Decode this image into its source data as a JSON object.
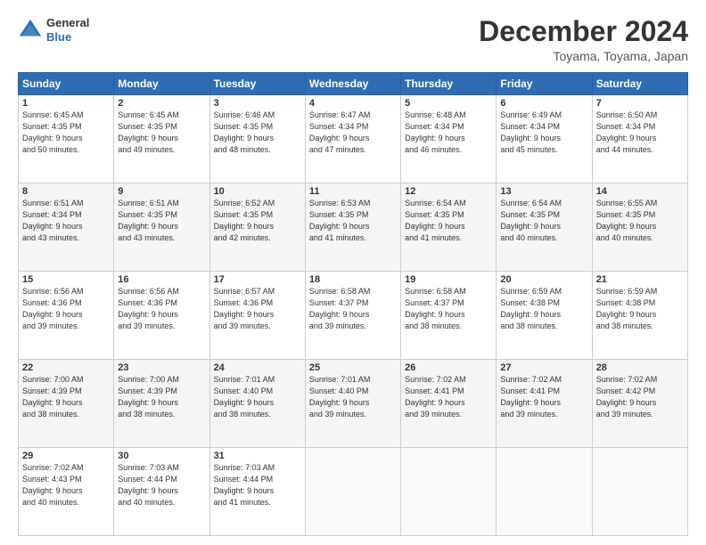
{
  "header": {
    "logo_general": "General",
    "logo_blue": "Blue",
    "month_title": "December 2024",
    "location": "Toyama, Toyama, Japan"
  },
  "weekdays": [
    "Sunday",
    "Monday",
    "Tuesday",
    "Wednesday",
    "Thursday",
    "Friday",
    "Saturday"
  ],
  "weeks": [
    [
      {
        "day": "1",
        "info": "Sunrise: 6:45 AM\nSunset: 4:35 PM\nDaylight: 9 hours\nand 50 minutes."
      },
      {
        "day": "2",
        "info": "Sunrise: 6:45 AM\nSunset: 4:35 PM\nDaylight: 9 hours\nand 49 minutes."
      },
      {
        "day": "3",
        "info": "Sunrise: 6:46 AM\nSunset: 4:35 PM\nDaylight: 9 hours\nand 48 minutes."
      },
      {
        "day": "4",
        "info": "Sunrise: 6:47 AM\nSunset: 4:34 PM\nDaylight: 9 hours\nand 47 minutes."
      },
      {
        "day": "5",
        "info": "Sunrise: 6:48 AM\nSunset: 4:34 PM\nDaylight: 9 hours\nand 46 minutes."
      },
      {
        "day": "6",
        "info": "Sunrise: 6:49 AM\nSunset: 4:34 PM\nDaylight: 9 hours\nand 45 minutes."
      },
      {
        "day": "7",
        "info": "Sunrise: 6:50 AM\nSunset: 4:34 PM\nDaylight: 9 hours\nand 44 minutes."
      }
    ],
    [
      {
        "day": "8",
        "info": "Sunrise: 6:51 AM\nSunset: 4:34 PM\nDaylight: 9 hours\nand 43 minutes."
      },
      {
        "day": "9",
        "info": "Sunrise: 6:51 AM\nSunset: 4:35 PM\nDaylight: 9 hours\nand 43 minutes."
      },
      {
        "day": "10",
        "info": "Sunrise: 6:52 AM\nSunset: 4:35 PM\nDaylight: 9 hours\nand 42 minutes."
      },
      {
        "day": "11",
        "info": "Sunrise: 6:53 AM\nSunset: 4:35 PM\nDaylight: 9 hours\nand 41 minutes."
      },
      {
        "day": "12",
        "info": "Sunrise: 6:54 AM\nSunset: 4:35 PM\nDaylight: 9 hours\nand 41 minutes."
      },
      {
        "day": "13",
        "info": "Sunrise: 6:54 AM\nSunset: 4:35 PM\nDaylight: 9 hours\nand 40 minutes."
      },
      {
        "day": "14",
        "info": "Sunrise: 6:55 AM\nSunset: 4:35 PM\nDaylight: 9 hours\nand 40 minutes."
      }
    ],
    [
      {
        "day": "15",
        "info": "Sunrise: 6:56 AM\nSunset: 4:36 PM\nDaylight: 9 hours\nand 39 minutes."
      },
      {
        "day": "16",
        "info": "Sunrise: 6:56 AM\nSunset: 4:36 PM\nDaylight: 9 hours\nand 39 minutes."
      },
      {
        "day": "17",
        "info": "Sunrise: 6:57 AM\nSunset: 4:36 PM\nDaylight: 9 hours\nand 39 minutes."
      },
      {
        "day": "18",
        "info": "Sunrise: 6:58 AM\nSunset: 4:37 PM\nDaylight: 9 hours\nand 39 minutes."
      },
      {
        "day": "19",
        "info": "Sunrise: 6:58 AM\nSunset: 4:37 PM\nDaylight: 9 hours\nand 38 minutes."
      },
      {
        "day": "20",
        "info": "Sunrise: 6:59 AM\nSunset: 4:38 PM\nDaylight: 9 hours\nand 38 minutes."
      },
      {
        "day": "21",
        "info": "Sunrise: 6:59 AM\nSunset: 4:38 PM\nDaylight: 9 hours\nand 38 minutes."
      }
    ],
    [
      {
        "day": "22",
        "info": "Sunrise: 7:00 AM\nSunset: 4:39 PM\nDaylight: 9 hours\nand 38 minutes."
      },
      {
        "day": "23",
        "info": "Sunrise: 7:00 AM\nSunset: 4:39 PM\nDaylight: 9 hours\nand 38 minutes."
      },
      {
        "day": "24",
        "info": "Sunrise: 7:01 AM\nSunset: 4:40 PM\nDaylight: 9 hours\nand 38 minutes."
      },
      {
        "day": "25",
        "info": "Sunrise: 7:01 AM\nSunset: 4:40 PM\nDaylight: 9 hours\nand 39 minutes."
      },
      {
        "day": "26",
        "info": "Sunrise: 7:02 AM\nSunset: 4:41 PM\nDaylight: 9 hours\nand 39 minutes."
      },
      {
        "day": "27",
        "info": "Sunrise: 7:02 AM\nSunset: 4:41 PM\nDaylight: 9 hours\nand 39 minutes."
      },
      {
        "day": "28",
        "info": "Sunrise: 7:02 AM\nSunset: 4:42 PM\nDaylight: 9 hours\nand 39 minutes."
      }
    ],
    [
      {
        "day": "29",
        "info": "Sunrise: 7:02 AM\nSunset: 4:43 PM\nDaylight: 9 hours\nand 40 minutes."
      },
      {
        "day": "30",
        "info": "Sunrise: 7:03 AM\nSunset: 4:44 PM\nDaylight: 9 hours\nand 40 minutes."
      },
      {
        "day": "31",
        "info": "Sunrise: 7:03 AM\nSunset: 4:44 PM\nDaylight: 9 hours\nand 41 minutes."
      },
      null,
      null,
      null,
      null
    ]
  ]
}
